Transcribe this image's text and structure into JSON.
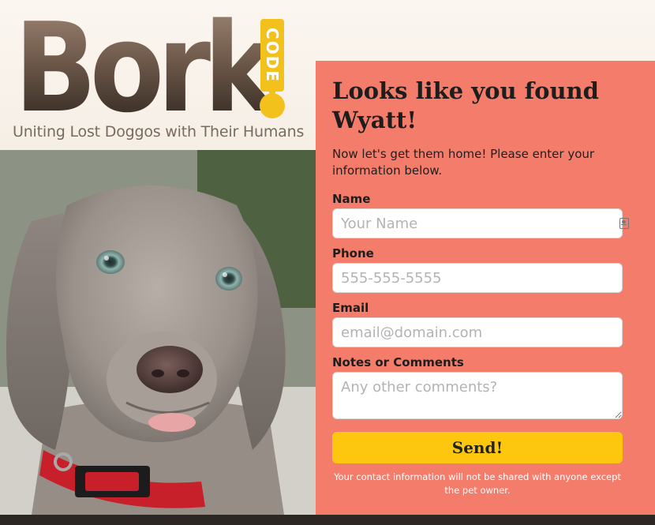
{
  "brand": {
    "word": "Bork",
    "tag_text": "CODE",
    "tagline": "Uniting Lost Doggos with Their Humans",
    "colors": {
      "word": "#4a3b31",
      "tag": "#f3c11b",
      "tagline": "#7a6a5e"
    }
  },
  "photo": {
    "subject": "weimaraner puppy with red collar",
    "collar_color": "#c8202a"
  },
  "form": {
    "title": "Looks like you found Wyatt!",
    "intro": "Now let's get them home! Please enter your information below.",
    "name": {
      "label": "Name",
      "placeholder": "Your Name",
      "icon": "contact-card-icon"
    },
    "phone": {
      "label": "Phone",
      "placeholder": "555-555-5555"
    },
    "email": {
      "label": "Email",
      "placeholder": "email@domain.com"
    },
    "notes": {
      "label": "Notes or Comments",
      "placeholder": "Any other comments?"
    },
    "send_label": "Send!",
    "privacy": "Your contact information will not be shared with anyone except the pet owner.",
    "colors": {
      "panel": "#f47c6b",
      "button": "#fcc70e"
    }
  }
}
